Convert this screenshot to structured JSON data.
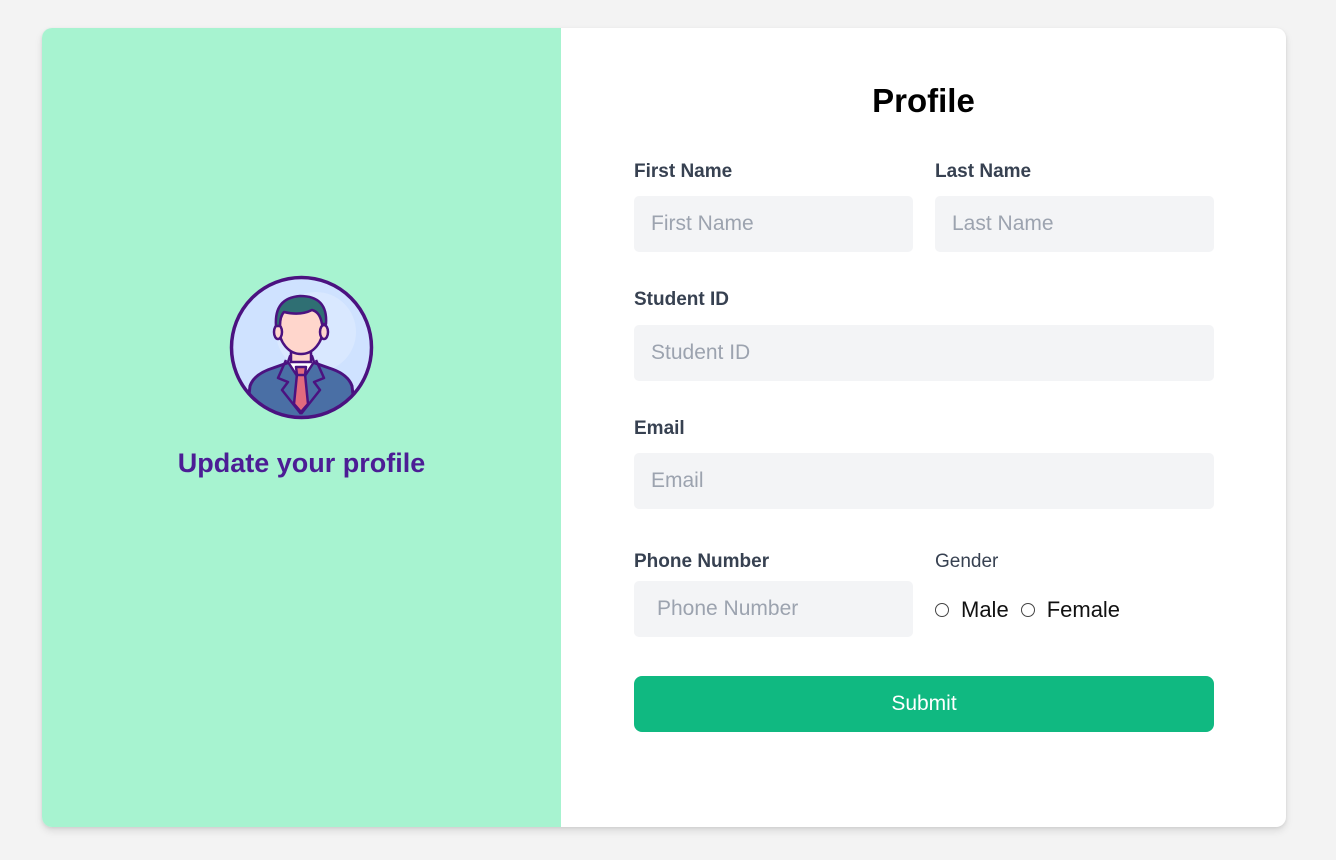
{
  "sidebar": {
    "heading": "Update your profile",
    "avatar_icon": "business-man-avatar-icon"
  },
  "form": {
    "title": "Profile",
    "first_name": {
      "label": "First Name",
      "placeholder": "First Name",
      "value": ""
    },
    "last_name": {
      "label": "Last Name",
      "placeholder": "Last Name",
      "value": ""
    },
    "student_id": {
      "label": "Student ID",
      "placeholder": "Student ID",
      "value": ""
    },
    "email": {
      "label": "Email",
      "placeholder": "Email",
      "value": ""
    },
    "phone": {
      "label": "Phone Number",
      "placeholder": "Phone Number",
      "value": ""
    },
    "gender": {
      "label": "Gender",
      "options": [
        "Male",
        "Female"
      ],
      "selected": null
    },
    "submit_label": "Submit"
  },
  "colors": {
    "page_bg": "#f3f3f3",
    "sidebar_bg": "#a7f3d0",
    "sidebar_heading": "#4c1d95",
    "input_bg": "#f3f4f6",
    "submit_bg": "#10b981"
  }
}
